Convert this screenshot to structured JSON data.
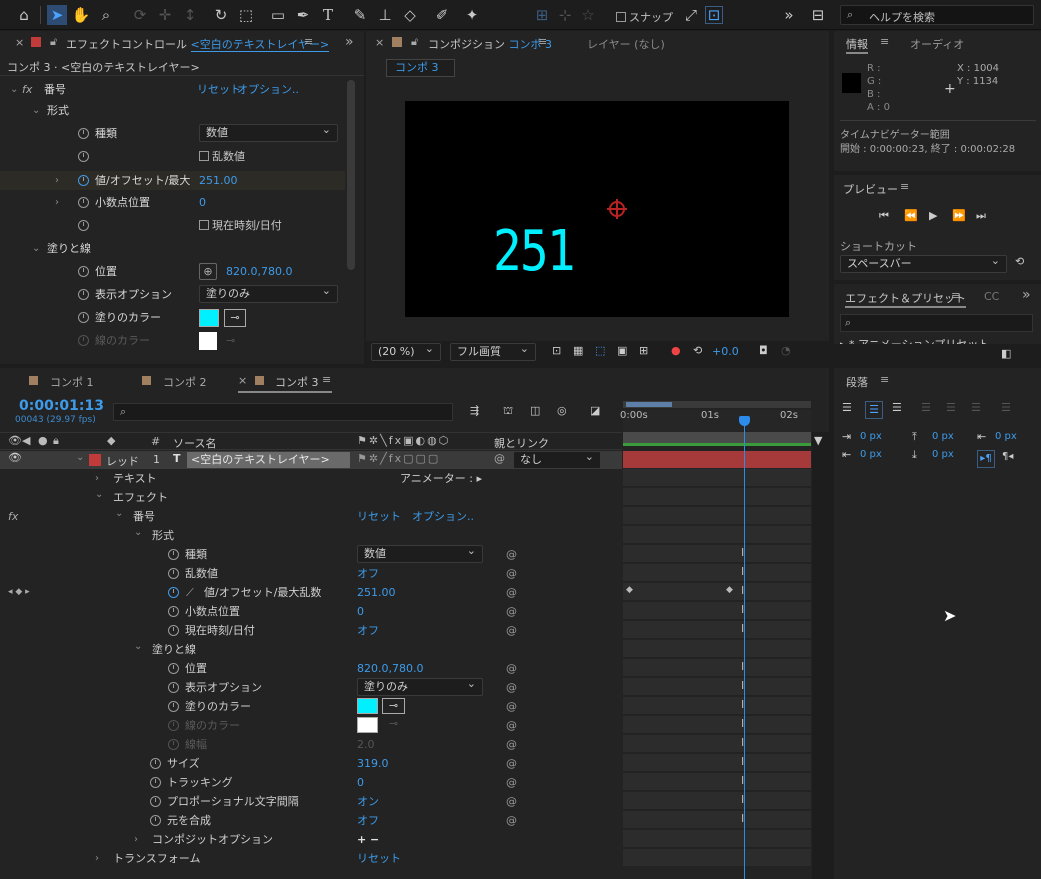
{
  "colors": {
    "accent": "#2d8ceb",
    "cyan": "#00f0ff",
    "layer_red": "#c23b3b",
    "timeline_bar": "#a63a3a"
  },
  "toolbar": {
    "snap_label": "スナップ",
    "search_placeholder": "ヘルプを検索"
  },
  "effect_controls": {
    "tab_title": "エフェクトコントロール",
    "tab_layer": "<空白のテキストレイヤー>",
    "breadcrumb": "コンポ 3 · <空白のテキストレイヤー>",
    "effect_name": "番号",
    "reset": "リセット",
    "options": "オプション..",
    "format_group": "形式",
    "type_label": "種類",
    "type_value": "数値",
    "random_label": "乱数値",
    "value_label": "値/オフセット/最大",
    "value": "251.00",
    "decimal_label": "小数点位置",
    "decimal_value": "0",
    "datetime_label": "現在時刻/日付",
    "fill_group": "塗りと線",
    "position_label": "位置",
    "position_value": "820.0,780.0",
    "display_label": "表示オプション",
    "display_value": "塗りのみ",
    "fill_color_label": "塗りのカラー",
    "stroke_color_label": "線のカラー"
  },
  "composition": {
    "tab_title": "コンポジション",
    "tab_comp": "コンポ 3",
    "layer_tab": "レイヤー (なし)",
    "comp_chip": "コンポ 3",
    "canvas_text": "251",
    "zoom": "(20 %)",
    "quality": "フル画質",
    "exposure": "+0.0"
  },
  "info": {
    "tab_info": "情報",
    "tab_audio": "オーディオ",
    "r": "R :",
    "g": "G :",
    "b": "B :",
    "a": "A : 0",
    "x": "X : 1004",
    "y": "Y : 1134",
    "nav_title": "タイムナビゲーター範囲",
    "nav_range": "開始 : 0:00:00:23, 終了 : 0:00:02:28"
  },
  "preview": {
    "title": "プレビュー",
    "shortcut_label": "ショートカット",
    "shortcut_value": "スペースバー"
  },
  "effects_presets": {
    "title": "エフェクト＆プリセット",
    "cc": "CC",
    "item": "▸ * アニメーションプリセット"
  },
  "paragraph": {
    "title": "段落",
    "indent_left": "0 px",
    "indent_first": "0 px",
    "space_before": "0 px",
    "indent_right": "0 px",
    "space_after": "0 px",
    "space_top": "0 px"
  },
  "timeline": {
    "tabs": [
      "コンポ 1",
      "コンポ 2",
      "コンポ 3"
    ],
    "timecode": "0:00:01:13",
    "fps": "00043 (29.97 fps)",
    "col_source": "ソース名",
    "col_parent": "親とリンク",
    "ruler": [
      "0:00s",
      "01s",
      "02s"
    ],
    "layer": {
      "label": "レッド",
      "num": "1",
      "type": "T",
      "name": "<空白のテキストレイヤー>",
      "parent": "なし"
    },
    "rows": [
      {
        "indent": 1,
        "label": "テキスト",
        "value": "",
        "extra": "アニメーター : ▸"
      },
      {
        "indent": 1,
        "label": "エフェクト",
        "value": ""
      },
      {
        "indent": 2,
        "label": "番号",
        "value": "リセット　オプション.."
      },
      {
        "indent": 3,
        "label": "形式",
        "value": ""
      },
      {
        "indent": 4,
        "label": "種類",
        "value": "数値",
        "select": true
      },
      {
        "indent": 4,
        "label": "乱数値",
        "value": "オフ"
      },
      {
        "indent": 4,
        "label": "値/オフセット/最大乱数",
        "value": "251.00",
        "kf": true
      },
      {
        "indent": 4,
        "label": "小数点位置",
        "value": "0"
      },
      {
        "indent": 4,
        "label": "現在時刻/日付",
        "value": "オフ"
      },
      {
        "indent": 3,
        "label": "塗りと線",
        "value": ""
      },
      {
        "indent": 4,
        "label": "位置",
        "value": "820.0,780.0"
      },
      {
        "indent": 4,
        "label": "表示オプション",
        "value": "塗りのみ",
        "select": true
      },
      {
        "indent": 4,
        "label": "塗りのカラー",
        "value": "",
        "swatch": "cyan"
      },
      {
        "indent": 4,
        "label": "線のカラー",
        "value": "",
        "swatch": "white",
        "dim": true
      },
      {
        "indent": 4,
        "label": "線幅",
        "value": "2.0",
        "dim": true
      },
      {
        "indent": 3,
        "label": "サイズ",
        "value": "319.0"
      },
      {
        "indent": 3,
        "label": "トラッキング",
        "value": "0"
      },
      {
        "indent": 3,
        "label": "プロポーショナル文字間隔",
        "value": "オン"
      },
      {
        "indent": 3,
        "label": "元を合成",
        "value": "オフ"
      },
      {
        "indent": 3,
        "label": "コンポジットオプション",
        "value": "+ −"
      },
      {
        "indent": 1,
        "label": "トランスフォーム",
        "value": "リセット"
      }
    ]
  }
}
